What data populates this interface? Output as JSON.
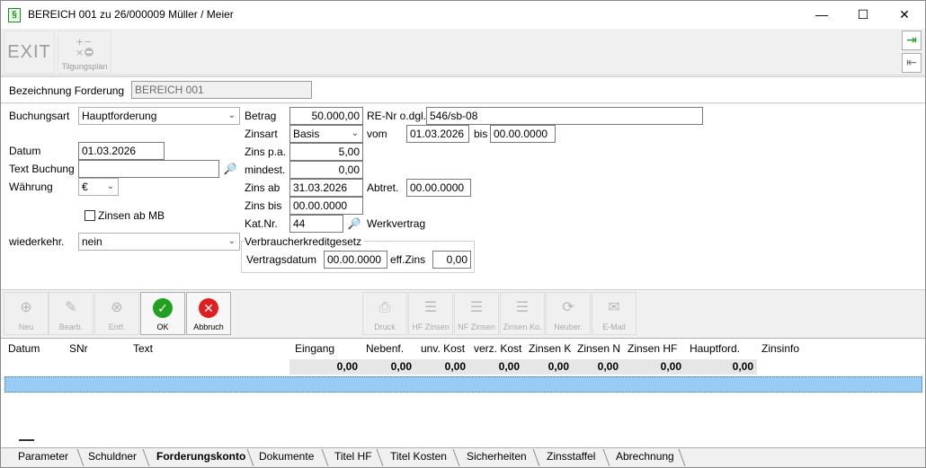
{
  "window": {
    "title": "BEREICH 001 zu 26/000009 Müller / Meier",
    "minimize": "—",
    "maximize": "☐",
    "close": "✕"
  },
  "toolbar": {
    "exit_label": "EXIT",
    "tilgungsplan_label": "Tilgungsplan"
  },
  "header": {
    "bezeichnung_label": "Bezeichnung Forderung",
    "bezeichnung_value": "BEREICH 001"
  },
  "form": {
    "buchungsart_label": "Buchungsart",
    "buchungsart_value": "Hauptforderung",
    "datum_label": "Datum",
    "datum_value": "01.03.2026",
    "text_buchung_label": "Text Buchung",
    "text_buchung_value": "",
    "waehrung_label": "Währung",
    "waehrung_value": "€",
    "zinsen_ab_mb_label": "Zinsen ab MB",
    "wiederkehr_label": "wiederkehr.",
    "wiederkehr_value": "nein",
    "betrag_label": "Betrag",
    "betrag_value": "50.000,00",
    "zinsart_label": "Zinsart",
    "zinsart_value": "Basis",
    "zins_pa_label": "Zins p.a.",
    "zins_pa_value": "5,00",
    "mindest_label": "mindest.",
    "mindest_value": "0,00",
    "zins_ab_label": "Zins ab",
    "zins_ab_value": "31.03.2026",
    "zins_bis_label": "Zins bis",
    "zins_bis_value": "00.00.0000",
    "katnr_label": "Kat.Nr.",
    "katnr_value": "44",
    "katnr_desc": "Werkvertrag",
    "renr_label": "RE-Nr o.dgl.",
    "renr_value": "546/sb-08",
    "vom_label": "vom",
    "vom_value": "01.03.2026",
    "bis_label": "bis",
    "bis_value": "00.00.0000",
    "abtret_label": "Abtret.",
    "abtret_value": "00.00.0000",
    "vkg_title": "Verbraucherkreditgesetz",
    "vertragsdatum_label": "Vertragsdatum",
    "vertragsdatum_value": "00.00.0000",
    "effzins_label": "eff.Zins",
    "effzins_value": "0,00"
  },
  "actions": {
    "neu": "Neu",
    "bearb": "Bearb.",
    "entf": "Entf.",
    "ok": "OK",
    "abbruch": "Abbruch",
    "druck": "Druck",
    "hf_zinsen": "HF Zinsen",
    "nf_zinsen": "NF Zinsen",
    "zinsen_ko": "Zinsen Ko.",
    "neuber": "Neuber.",
    "email": "E-Mail"
  },
  "grid": {
    "headers": [
      "Datum",
      "SNr",
      "Text",
      "Eingang",
      "Nebenf.",
      "unv. Kost",
      "verz. Kost",
      "Zinsen K",
      "Zinsen N",
      "Zinsen HF",
      "Hauptford.",
      "Zinsinfo"
    ],
    "sums": [
      "0,00",
      "0,00",
      "0,00",
      "0,00",
      "0,00",
      "0,00",
      "0,00",
      "0,00"
    ]
  },
  "tabs": [
    "Parameter",
    "Schuldner",
    "Forderungskonto",
    "Dokumente",
    "Titel HF",
    "Titel Kosten",
    "Sicherheiten",
    "Zinsstaffel",
    "Abrechnung"
  ],
  "active_tab": "Forderungskonto"
}
